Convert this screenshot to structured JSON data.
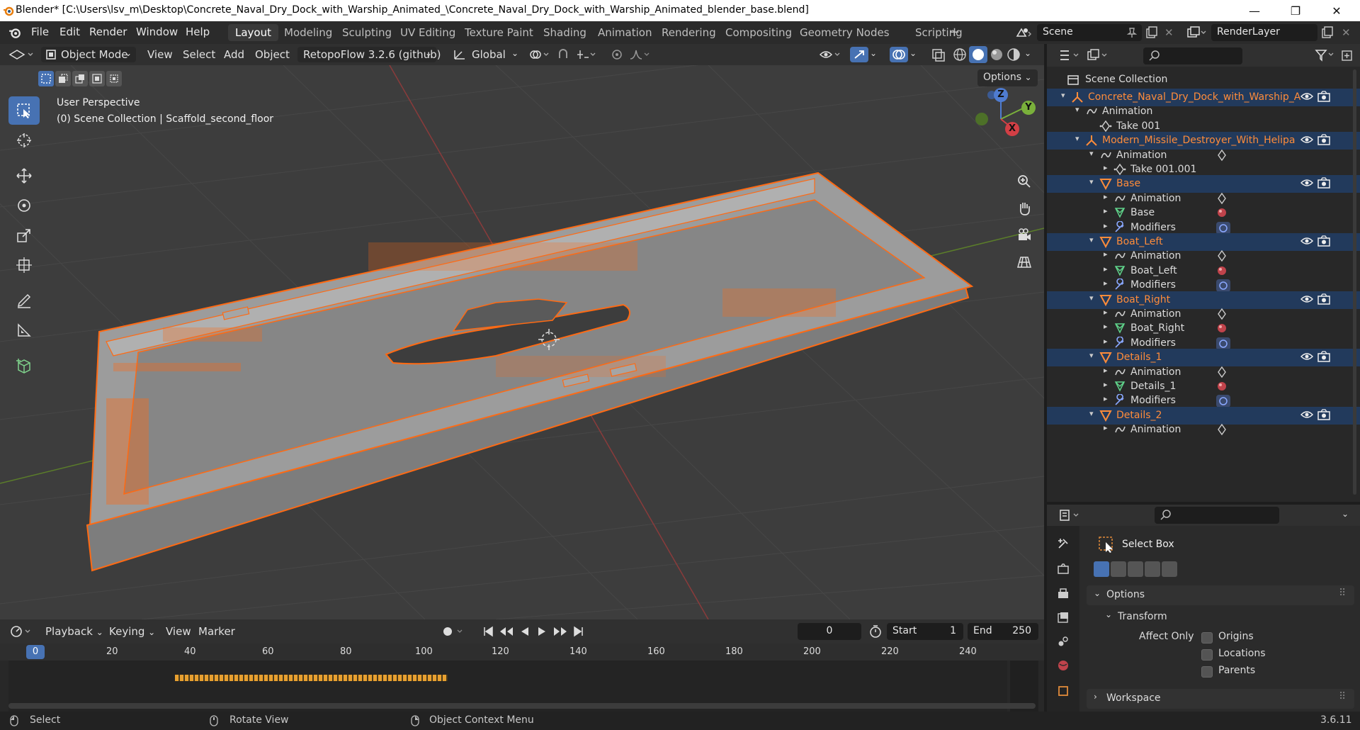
{
  "titlebar": {
    "title": "Blender* [C:\\Users\\lsv_m\\Desktop\\Concrete_Naval_Dry_Dock_with_Warship_Animated_\\Concrete_Naval_Dry_Dock_with_Warship_Animated_blender_base.blend]",
    "minimize": "—",
    "maximize": "❐",
    "close": "✕"
  },
  "menubar": {
    "items": [
      "File",
      "Edit",
      "Render",
      "Window",
      "Help"
    ]
  },
  "workspaces": {
    "tabs": [
      "Layout",
      "Modeling",
      "Sculpting",
      "UV Editing",
      "Texture Paint",
      "Shading",
      "Animation",
      "Rendering",
      "Compositing",
      "Geometry Nodes",
      "Scripting"
    ],
    "active": "Layout",
    "add": "+"
  },
  "scene": {
    "name": "Scene",
    "view_layer": "RenderLayer"
  },
  "viewport_header": {
    "mode": "Object Mode",
    "menus": [
      "View",
      "Select",
      "Add",
      "Object"
    ],
    "addon": "RetopoFlow 3.2.6 (github)",
    "orientation": "Global",
    "options": "Options"
  },
  "viewport": {
    "perspective": "User Perspective",
    "collection_info": "(0) Scene Collection | Scaffold_second_floor",
    "gizmo": {
      "z": "Z",
      "y": "Y",
      "x": "X"
    }
  },
  "outliner": {
    "root": "Scene Collection",
    "rows": [
      {
        "label": "Concrete_Naval_Dry_Dock_with_Warship_A",
        "indent": 0,
        "type": "armature",
        "color": "orange",
        "selected": true,
        "eye": true
      },
      {
        "label": "Animation",
        "indent": 1,
        "type": "anim",
        "color": "white",
        "selected": false,
        "eye": false
      },
      {
        "label": "Take 001",
        "indent": 2,
        "type": "action",
        "color": "white",
        "selected": false,
        "eye": false
      },
      {
        "label": "Modern_Missile_Destroyer_With_Helipa",
        "indent": 1,
        "type": "armature",
        "color": "orange",
        "selected": true,
        "eye": true
      },
      {
        "label": "Animation",
        "indent": 2,
        "type": "anim",
        "color": "white",
        "selected": false,
        "eye": false
      },
      {
        "label": "Take 001.001",
        "indent": 3,
        "type": "action",
        "color": "white",
        "selected": false,
        "eye": false
      },
      {
        "label": "Base",
        "indent": 2,
        "type": "mesh",
        "color": "orange",
        "selected": true,
        "eye": true
      },
      {
        "label": "Animation",
        "indent": 3,
        "type": "anim",
        "color": "white",
        "selected": false,
        "eye": false
      },
      {
        "label": "Base",
        "indent": 3,
        "type": "meshdata",
        "color": "white",
        "selected": false,
        "eye": false
      },
      {
        "label": "Modifiers",
        "indent": 3,
        "type": "wrench",
        "color": "white",
        "selected": false,
        "eye": false
      },
      {
        "label": "Boat_Left",
        "indent": 2,
        "type": "mesh",
        "color": "orange",
        "selected": true,
        "eye": true
      },
      {
        "label": "Animation",
        "indent": 3,
        "type": "anim",
        "color": "white",
        "selected": false,
        "eye": false
      },
      {
        "label": "Boat_Left",
        "indent": 3,
        "type": "meshdata",
        "color": "white",
        "selected": false,
        "eye": false
      },
      {
        "label": "Modifiers",
        "indent": 3,
        "type": "wrench",
        "color": "white",
        "selected": false,
        "eye": false
      },
      {
        "label": "Boat_Right",
        "indent": 2,
        "type": "mesh",
        "color": "orange",
        "selected": true,
        "eye": true
      },
      {
        "label": "Animation",
        "indent": 3,
        "type": "anim",
        "color": "white",
        "selected": false,
        "eye": false
      },
      {
        "label": "Boat_Right",
        "indent": 3,
        "type": "meshdata",
        "color": "white",
        "selected": false,
        "eye": false
      },
      {
        "label": "Modifiers",
        "indent": 3,
        "type": "wrench",
        "color": "white",
        "selected": false,
        "eye": false
      },
      {
        "label": "Details_1",
        "indent": 2,
        "type": "mesh",
        "color": "orange",
        "selected": true,
        "eye": true
      },
      {
        "label": "Animation",
        "indent": 3,
        "type": "anim",
        "color": "white",
        "selected": false,
        "eye": false
      },
      {
        "label": "Details_1",
        "indent": 3,
        "type": "meshdata",
        "color": "white",
        "selected": false,
        "eye": false
      },
      {
        "label": "Modifiers",
        "indent": 3,
        "type": "wrench",
        "color": "white",
        "selected": false,
        "eye": false
      },
      {
        "label": "Details_2",
        "indent": 2,
        "type": "mesh",
        "color": "orange",
        "selected": true,
        "eye": true
      },
      {
        "label": "Animation",
        "indent": 3,
        "type": "anim",
        "color": "white",
        "selected": false,
        "eye": false
      }
    ]
  },
  "properties": {
    "tool_name": "Select Box",
    "options_label": "Options",
    "transform_label": "Transform",
    "affect_only": "Affect Only",
    "checks": [
      "Origins",
      "Locations",
      "Parents"
    ],
    "workspace_label": "Workspace"
  },
  "timeline": {
    "menus": [
      "Playback",
      "Keying",
      "View",
      "Marker"
    ],
    "current_frame": "0",
    "start_label": "Start",
    "start": "1",
    "end_label": "End",
    "end": "250",
    "ruler": [
      "0",
      "20",
      "40",
      "60",
      "80",
      "100",
      "120",
      "140",
      "160",
      "180",
      "200",
      "220",
      "240"
    ]
  },
  "statusbar": {
    "select": "Select",
    "rotate": "Rotate View",
    "context": "Object Context Menu",
    "version": "3.6.11"
  },
  "colors": {
    "selection": "#ff6a13",
    "accent": "#4772b3",
    "outliner_selected": "#223a5c"
  }
}
